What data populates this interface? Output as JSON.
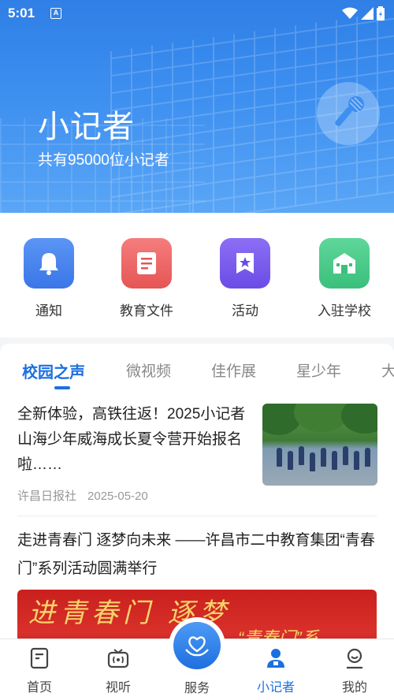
{
  "status_bar": {
    "time": "5:01",
    "notification_icon_letter": "A"
  },
  "header": {
    "title": "小记者",
    "subtitle": "共有95000位小记者",
    "gradient_top": "#2f7fe6",
    "gradient_bottom": "#5aa6f6"
  },
  "shortcuts": [
    {
      "label": "通知",
      "icon": "bell-icon",
      "color": "#4a86f0"
    },
    {
      "label": "教育文件",
      "icon": "document-icon",
      "color": "#ee6868"
    },
    {
      "label": "活动",
      "icon": "star-badge-icon",
      "color": "#7e5ff0"
    },
    {
      "label": "入驻学校",
      "icon": "school-icon",
      "color": "#4cc98a"
    }
  ],
  "tabs": [
    {
      "label": "校园之声",
      "active": true
    },
    {
      "label": "微视频",
      "active": false
    },
    {
      "label": "佳作展",
      "active": false
    },
    {
      "label": "星少年",
      "active": false
    },
    {
      "label": "大",
      "active": false
    }
  ],
  "articles": [
    {
      "title": "全新体验，高铁往返！2025小记者山海少年威海成长夏令营开始报名啦……",
      "source": "许昌日报社",
      "date": "2025-05-20",
      "thumbnail": "students-outdoor-photo"
    },
    {
      "title": "走进青春门  逐梦向未来 ——许昌市二中教育集团“青春门”系列活动圆满举行",
      "banner_text": "进青春门  逐梦",
      "banner_subtext": "“青春门”系"
    }
  ],
  "bottom_nav": {
    "items": [
      {
        "label": "首页",
        "icon": "home-doc-icon",
        "active": false
      },
      {
        "label": "视听",
        "icon": "tv-icon",
        "active": false
      },
      {
        "label": "服务",
        "icon": "heart-hand-icon",
        "active": false
      },
      {
        "label": "小记者",
        "icon": "reporter-icon",
        "active": true
      },
      {
        "label": "我的",
        "icon": "profile-icon",
        "active": false
      }
    ],
    "accent": "#1c6fe0"
  }
}
